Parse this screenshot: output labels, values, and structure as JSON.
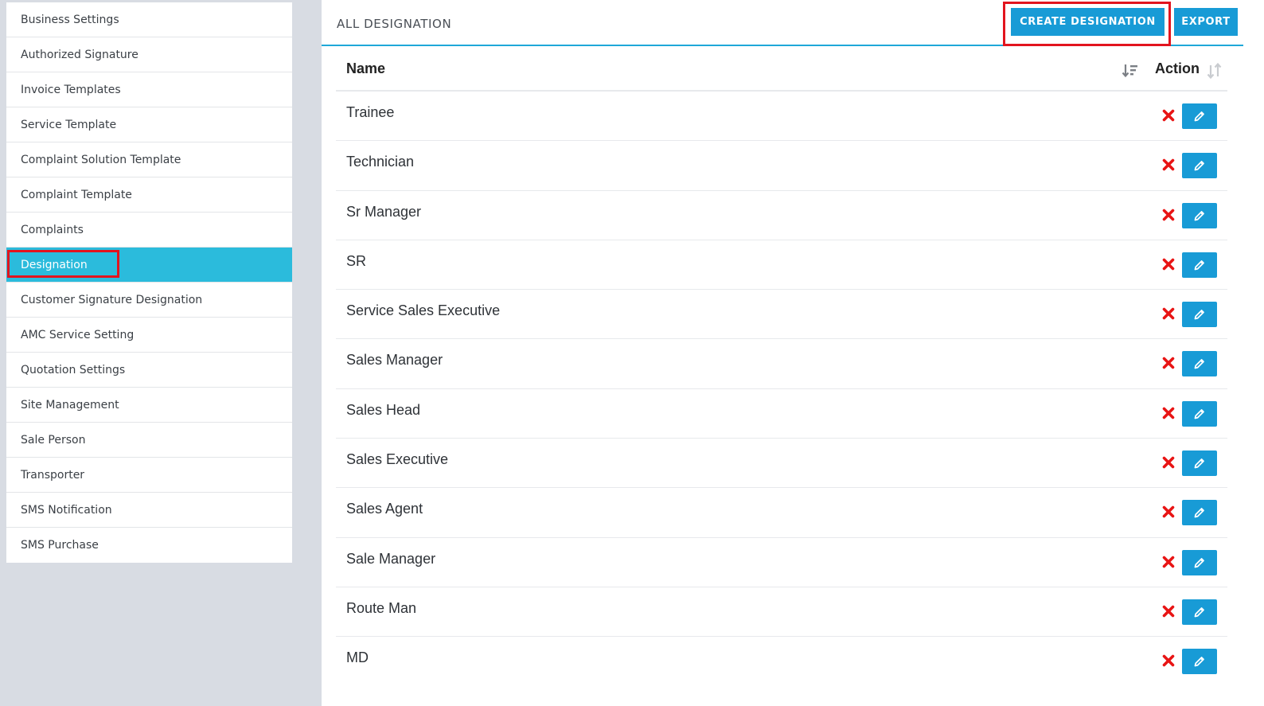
{
  "sidebar": {
    "items": [
      {
        "label": "Business Settings",
        "active": false
      },
      {
        "label": "Authorized Signature",
        "active": false
      },
      {
        "label": "Invoice Templates",
        "active": false
      },
      {
        "label": "Service Template",
        "active": false
      },
      {
        "label": "Complaint Solution Template",
        "active": false
      },
      {
        "label": "Complaint Template",
        "active": false
      },
      {
        "label": "Complaints",
        "active": false
      },
      {
        "label": "Designation",
        "active": true
      },
      {
        "label": "Customer Signature Designation",
        "active": false
      },
      {
        "label": "AMC Service Setting",
        "active": false
      },
      {
        "label": "Quotation Settings",
        "active": false
      },
      {
        "label": "Site Management",
        "active": false
      },
      {
        "label": "Sale Person",
        "active": false
      },
      {
        "label": "Transporter",
        "active": false
      },
      {
        "label": "SMS Notification",
        "active": false
      },
      {
        "label": "SMS Purchase",
        "active": false
      }
    ]
  },
  "header": {
    "title": "ALL DESIGNATION",
    "create_label": "CREATE DESIGNATION",
    "export_label": "EXPORT"
  },
  "table": {
    "columns": {
      "name": "Name",
      "action": "Action"
    },
    "rows": [
      "Trainee",
      "Technician",
      "Sr Manager",
      "SR",
      "Service Sales Executive",
      "Sales Manager",
      "Sales Head",
      "Sales Executive",
      "Sales Agent",
      "Sale Manager",
      "Route Man",
      "MD"
    ],
    "row_actions": {
      "delete_icon": "close-icon",
      "edit_icon": "pencil-icon"
    }
  },
  "colors": {
    "accent": "#189bd6",
    "sidebar_active": "#2bbbdc",
    "delete": "#e81414",
    "highlight_box": "#e2141e"
  }
}
